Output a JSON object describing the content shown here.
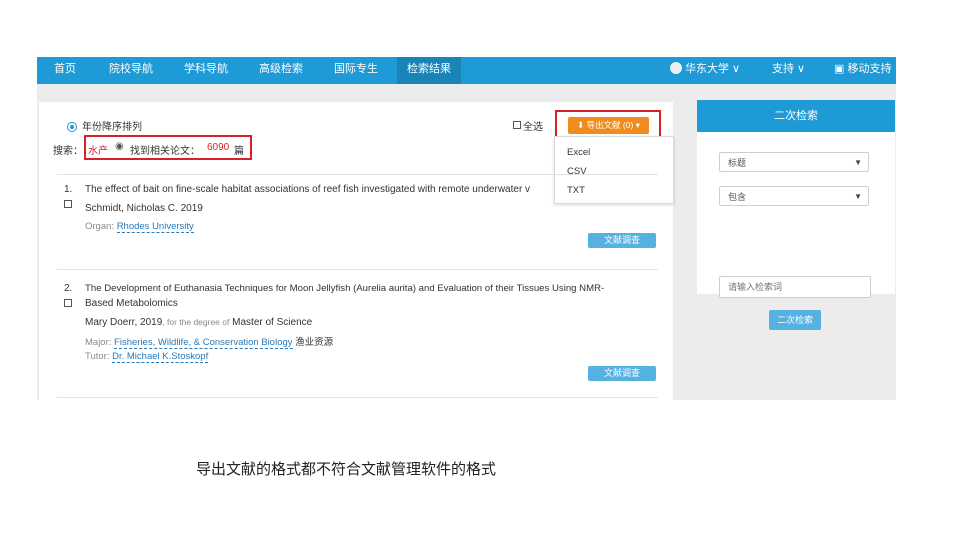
{
  "nav": {
    "items": [
      "首页",
      "院校导航",
      "学科导航",
      "高级检索",
      "国际专生",
      "检索结果"
    ],
    "user": "华东大学 ∨",
    "support": "支持 ∨",
    "mobile": "移动支持"
  },
  "toolbar": {
    "sort_label": "年份降序排列",
    "select_all": "全选",
    "export_label": "导出文献 (0) ▾",
    "export_menu": [
      "Excel",
      "CSV",
      "TXT"
    ]
  },
  "search_summary": {
    "prefix": "搜索：",
    "term": "水产",
    "found": "找到相关论文：",
    "count": "6090",
    "unit": "篇"
  },
  "results": [
    {
      "num": "1.",
      "title": "The effect of bait on fine-scale habitat associations of reef fish investigated with remote underwater v",
      "author": "Schmidt, Nicholas C. 2019",
      "org_label": "Organ:",
      "org": "Rhodes University",
      "button": "文献调查"
    },
    {
      "num": "2.",
      "title": "The Development of Euthanasia Techniques for Moon Jellyfish (Aurelia aurita) and Evaluation of their Tissues Using NMR-",
      "title2": "Based Metabolomics",
      "author": "Mary Doerr, 2019",
      "degree_pre": ", for the degree of",
      "degree": "Master of Science",
      "major_label": "Major:",
      "major": "Fisheries, Wildlife, & Conservation Biology",
      "tag": "渔业资源",
      "tutor_label": "Tutor:",
      "tutor": "Dr. Michael K.Stoskopf",
      "button": "文献调查"
    }
  ],
  "side": {
    "header": "二次检索",
    "field_select": "标题",
    "mode_select": "包含",
    "keyword_placeholder": "请输入检索词",
    "search_button": "二次检索"
  },
  "caption": "导出文献的格式都不符合文献管理软件的格式",
  "colors": {
    "nav": "#1e9ad6",
    "export": "#f08c1d",
    "highlight_box": "#d7202a",
    "count": "#d7202a"
  }
}
